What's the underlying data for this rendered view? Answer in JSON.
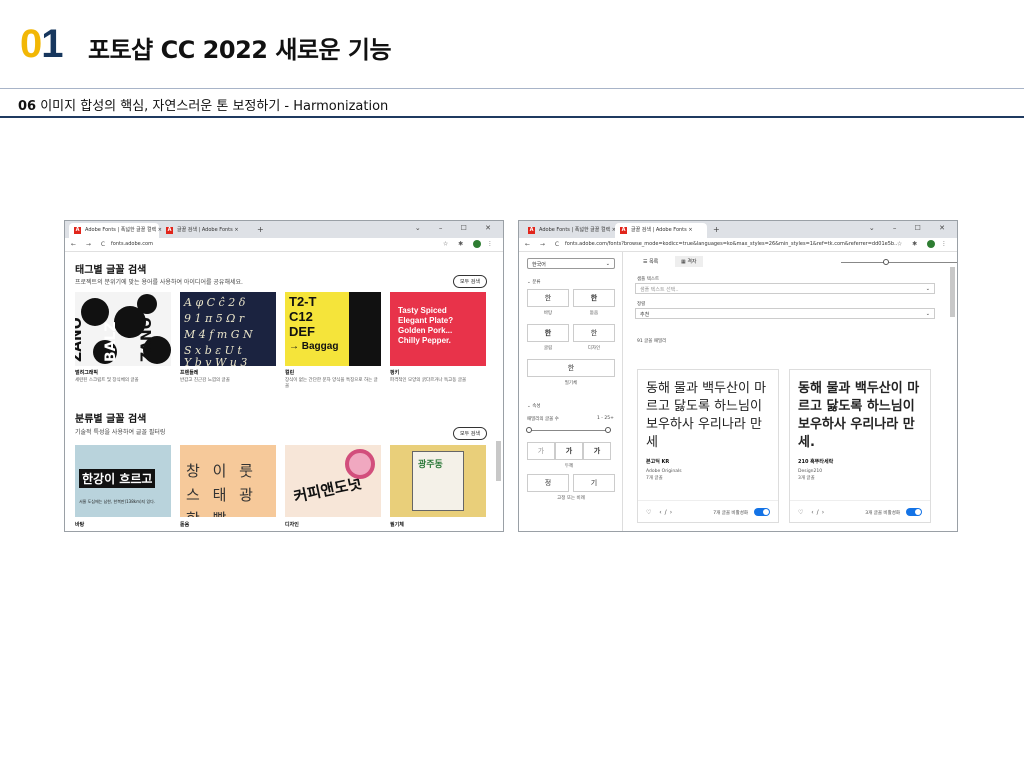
{
  "slide": {
    "number": "01",
    "number_first_digit": "0",
    "number_second_digit": "1",
    "title": "포토샵 CC 2022 새로운 기능",
    "subtitle_prefix": "06",
    "subtitle_text": " 이미지 합성의 핵심, 자연스러운 톤 보정하기 - Harmonization",
    "accent_color": "#f2b705",
    "brand_color": "#17375e"
  },
  "left_window": {
    "tabs": [
      {
        "label": "Adobe Fonts | 폭넓한 글꼴 컬렉 ×",
        "active": true
      },
      {
        "label": "글꼴 검색 | Adobe Fonts ×",
        "active": false
      }
    ],
    "url": "fonts.adobe.com",
    "section1_title": "태그별 글꼴 검색",
    "section1_desc": "프로젝트의 분위기에 맞는 용어를 사용하여 아이디어를 공유해세요.",
    "section1_button": "모두 검색",
    "cards1": [
      {
        "label": "벌려그래픽",
        "desc": "세련된 스크립트 및 장식체의 글꼴"
      },
      {
        "label": "프렌들레",
        "desc": "반갑고 친근감 느낌의 글꼴"
      },
      {
        "label": "컬린",
        "desc": "장식이 없는 간단한 문자 양식을 특징으로 하는 글꼴"
      },
      {
        "label": "펑키",
        "desc": "파격적인 모양의 굵다르거나 독고동 글꼴"
      }
    ],
    "card_texts": {
      "c3_line1": "T2-T",
      "c3_line2": "C12",
      "c3_line3": "DEF",
      "c3_line4": "→ Baggag",
      "c4_lines": [
        "Tasty Spiced",
        "Elegant Plate?",
        "Golden Pork...",
        "Chilly Pepper."
      ]
    },
    "section2_title": "분류별 글꼴 검색",
    "section2_desc": "기술적 특성을 사용하여 글꼴 필터링",
    "section2_button": "모두 검색",
    "cards2": [
      {
        "label": "바탕",
        "headline": "한강이 흐르고",
        "body": "서울 도심에는 남한, 한복판(138km)지 있다."
      },
      {
        "label": "돋움",
        "headline": "창 이 룻 스 태 광 함 빨"
      },
      {
        "label": "디자인",
        "headline": "커피앤도넛"
      },
      {
        "label": "필기체",
        "headline": "광주동"
      }
    ]
  },
  "right_window": {
    "tabs": [
      {
        "label": "Adobe Fonts | 폭넓한 글꼴 컬렉 ×",
        "active": false
      },
      {
        "label": "글꼴 검색 | Adobe Fonts ×",
        "active": true
      }
    ],
    "url": "fonts.adobe.com/fonts?browse_mode=kodicc=true&languages=ko&max_styles=26&min_styles=1&ref=tk.com&referrer=dd01e5b...",
    "language_select": "한국어",
    "sidebar": {
      "classification_label": "분류",
      "buttons": [
        {
          "glyph": "한",
          "label": "바탕"
        },
        {
          "glyph": "한",
          "label": "돋움"
        },
        {
          "glyph": "한",
          "label": "굴림"
        },
        {
          "glyph": "한",
          "label": "디자인"
        },
        {
          "glyph": "한",
          "label": "필기체"
        }
      ],
      "props_label": "속성",
      "weight_label": "패밀리의 글꼴 수",
      "weight_range": "1 - 25+",
      "style_buttons": [
        "가",
        "가",
        "가"
      ],
      "style_label": "두께",
      "width_buttons": [
        "정",
        "기"
      ],
      "width_label": "고정 또는 비례"
    },
    "view_tabs": [
      "목록",
      "격자"
    ],
    "sample_text_label": "샘플 텍스트",
    "sample_text_placeholder": "샘플 텍스트 선택..",
    "sort_label": "정렬",
    "sort_value": "추천",
    "result_count": "91 글꼴 패밀리",
    "font_cards": [
      {
        "sample": "동해 물과 백두산이 마르고 닳도록 하느님이 보우하사 우리나라 만세",
        "name": "본고딕 KR",
        "foundry": "Adobe Originals",
        "count": "7개 글꼴",
        "toggle_label": "7개 글꼴 비활성화"
      },
      {
        "sample": "동해 물과 백두산이 마르고 닳도록 하느님이 보우하사 우리나라 만세.",
        "name": "210 흑뚜타세락",
        "foundry": "Design210",
        "count": "3개 글꼴",
        "toggle_label": "3개 글꼴 비활성화"
      }
    ]
  }
}
